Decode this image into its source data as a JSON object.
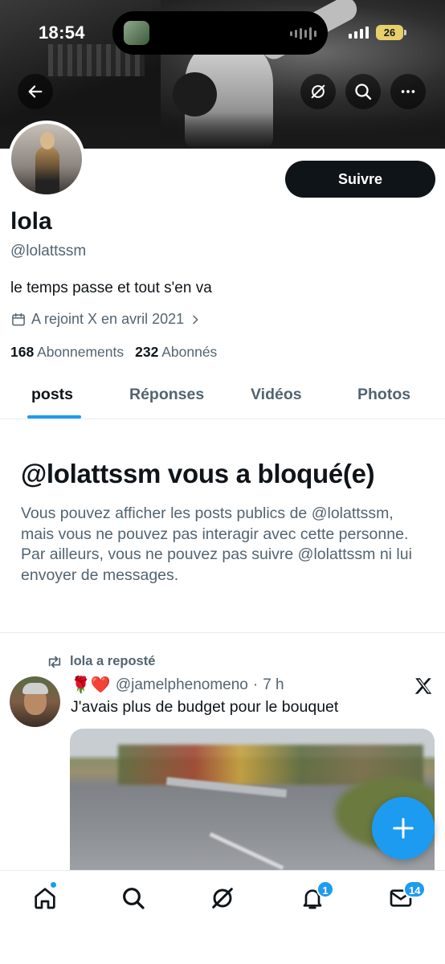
{
  "status_bar": {
    "time": "18:54",
    "battery": "26"
  },
  "profile": {
    "name": "lola",
    "handle": "@lolattssm",
    "bio": "le temps passe et tout s'en va",
    "joined": "A rejoint X en avril 2021",
    "following_count": "168",
    "following_label": "Abonnements",
    "followers_count": "232",
    "followers_label": "Abonnés",
    "follow_button": "Suivre"
  },
  "tabs": [
    {
      "label": "posts",
      "active": true
    },
    {
      "label": "Réponses",
      "active": false
    },
    {
      "label": "Vidéos",
      "active": false
    },
    {
      "label": "Photos",
      "active": false
    }
  ],
  "blocked": {
    "title": "@lolattssm vous a bloqué(e)",
    "text": "Vous pouvez afficher les posts publics de @lolattssm, mais vous ne pouvez pas interagir avec cette personne. Par ailleurs, vous ne pouvez pas suivre @lolattssm ni lui envoyer de messages."
  },
  "tweet": {
    "repost_label": "lola a reposté",
    "emojis": "🌹❤️",
    "author_handle": "@jamelphenomeno",
    "separator": "·",
    "time": "7 h",
    "text": "J'avais plus de budget pour le bouquet"
  },
  "bottom_nav": {
    "notifications_badge": "1",
    "messages_badge": "14"
  },
  "colors": {
    "accent": "#1d9bf0",
    "text_primary": "#0f1419",
    "text_secondary": "#536471",
    "battery": "#e7d06a"
  },
  "icons": [
    "back-arrow-icon",
    "grok-icon",
    "search-icon",
    "more-icon",
    "calendar-icon",
    "chevron-right-icon",
    "repost-icon",
    "x-logo-icon",
    "plus-icon",
    "home-icon",
    "grok-nav-icon",
    "bell-icon",
    "mail-icon"
  ]
}
